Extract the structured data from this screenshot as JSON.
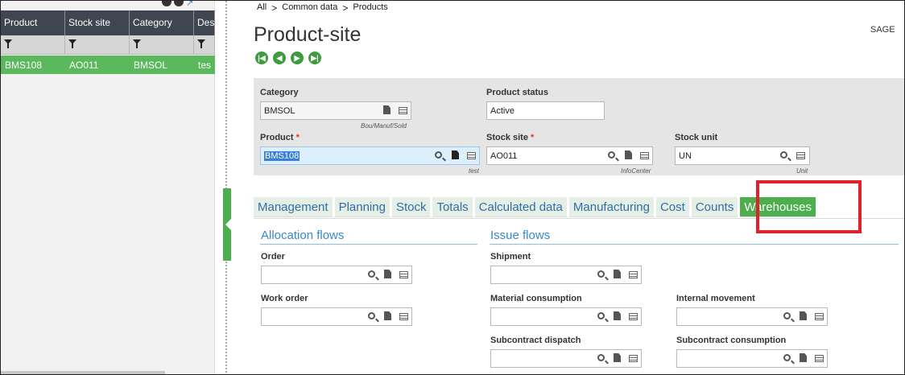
{
  "grid": {
    "columns": [
      "Product",
      "Stock site",
      "Category",
      "Des"
    ],
    "row": [
      "BMS108",
      "AO011",
      "BMSOL",
      "tes"
    ]
  },
  "breadcrumb": [
    "All",
    "Common data",
    "Products"
  ],
  "title": "Product-site",
  "user": "SAGE",
  "nav": {
    "first": "|◀",
    "prev": "◀",
    "next": "▶",
    "last": "▶|"
  },
  "header": {
    "category": {
      "label": "Category",
      "value": "BMSOL",
      "sub": "Bou/Manuf/Sold"
    },
    "product_status": {
      "label": "Product status",
      "value": "Active"
    },
    "product": {
      "label": "Product",
      "value": "BMS108",
      "sub": "test"
    },
    "stock_site": {
      "label": "Stock site",
      "value": "AO011",
      "sub": "InfoCenter"
    },
    "stock_unit": {
      "label": "Stock unit",
      "value": "UN",
      "sub": "Unit"
    }
  },
  "tabs": [
    "Management",
    "Planning",
    "Stock",
    "Totals",
    "Calculated data",
    "Manufacturing",
    "Cost",
    "Counts",
    "Warehouses"
  ],
  "active_tab": "Warehouses",
  "allocation": {
    "title": "Allocation flows",
    "order": "Order",
    "work_order": "Work order"
  },
  "issue": {
    "title": "Issue flows",
    "shipment": "Shipment",
    "material_consumption": "Material consumption",
    "internal_movement": "Internal movement",
    "subcontract_dispatch": "Subcontract dispatch",
    "subcontract_consumption": "Subcontract consumption"
  },
  "colors": {
    "accent": "#4cae4c",
    "highlight": "#e0202a",
    "link": "#3b87c9"
  }
}
